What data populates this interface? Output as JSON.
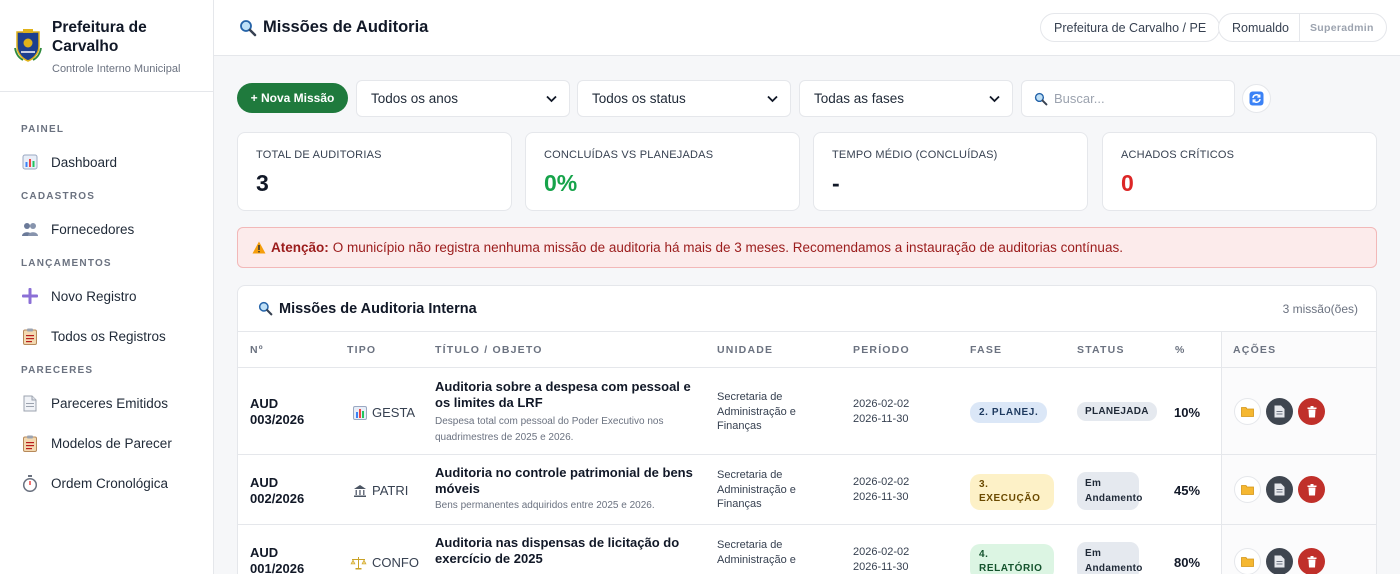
{
  "brand": {
    "name": "Prefeitura de Carvalho",
    "subtitle": "Controle Interno Municipal"
  },
  "sidebar": {
    "sections": [
      {
        "title": "PAINEL",
        "items": [
          {
            "label": "Dashboard",
            "icon": "chart-icon"
          }
        ]
      },
      {
        "title": "CADASTROS",
        "items": [
          {
            "label": "Fornecedores",
            "icon": "users-icon"
          }
        ]
      },
      {
        "title": "LANÇAMENTOS",
        "items": [
          {
            "label": "Novo Registro",
            "icon": "plus-icon"
          },
          {
            "label": "Todos os Registros",
            "icon": "clipboard-icon"
          }
        ]
      },
      {
        "title": "PARECERES",
        "items": [
          {
            "label": "Pareceres Emitidos",
            "icon": "document-icon"
          },
          {
            "label": "Modelos de Parecer",
            "icon": "clipboard-icon"
          },
          {
            "label": "Ordem Cronológica",
            "icon": "stopwatch-icon"
          }
        ]
      }
    ]
  },
  "header": {
    "title": "Missões de Auditoria",
    "tenant": "Prefeitura de Carvalho / PE",
    "user": "Romualdo",
    "role": "Superadmin"
  },
  "toolbar": {
    "new_label": "+ Nova Missão",
    "year_filter": "Todos os anos",
    "status_filter": "Todos os status",
    "phase_filter": "Todas as fases",
    "search_placeholder": "Buscar..."
  },
  "stats": [
    {
      "label": "TOTAL DE AUDITORIAS",
      "value": "3",
      "color": "#111827"
    },
    {
      "label": "CONCLUÍDAS VS PLANEJADAS",
      "value": "0%",
      "color": "#16a34a"
    },
    {
      "label": "TEMPO MÉDIO (CONCLUÍDAS)",
      "value": "-",
      "color": "#111827"
    },
    {
      "label": "ACHADOS CRÍTICOS",
      "value": "0",
      "color": "#dc2626"
    }
  ],
  "alert": {
    "label": "Atenção:",
    "message": "O município não registra nenhuma missão de auditoria há mais de 3 meses. Recomendamos a instauração de auditorias contínuas."
  },
  "table": {
    "title": "Missões de Auditoria Interna",
    "count": "3 missão(ões)",
    "columns": [
      "Nº",
      "TIPO",
      "TÍTULO / OBJETO",
      "UNIDADE",
      "PERÍODO",
      "FASE",
      "STATUS",
      "%",
      "AÇÕES"
    ],
    "rows": [
      {
        "num": "AUD 003/2026",
        "tipo": "GESTA",
        "tipo_icon": "bar-chart-icon",
        "titulo": "Auditoria sobre a despesa com pessoal e os limites da LRF",
        "descricao": "Despesa total com pessoal do Poder Executivo nos quadrimestres de 2025 e 2026.",
        "unidade": "Secretaria de Administração e Finanças",
        "inicio": "2026-02-02",
        "fim": "2026-11-30",
        "fase": "2. PLANEJ.",
        "fase_bg": "#dbe7f7",
        "fase_fg": "#1e3a5f",
        "status": "PLANEJADA",
        "pct": "10%"
      },
      {
        "num": "AUD 002/2026",
        "tipo": "PATRI",
        "tipo_icon": "building-icon",
        "titulo": "Auditoria no controle patrimonial de bens móveis",
        "descricao": "Bens permanentes adquiridos entre 2025 e 2026.",
        "unidade": "Secretaria de Administração e Finanças",
        "inicio": "2026-02-02",
        "fim": "2026-11-30",
        "fase": "3. EXECUÇÃO",
        "fase_bg": "#fdf1c7",
        "fase_fg": "#6b4a00",
        "status": "Em Andamento",
        "pct": "45%"
      },
      {
        "num": "AUD 001/2026",
        "tipo": "CONFO",
        "tipo_icon": "scales-icon",
        "titulo": "Auditoria nas dispensas de licitação do exercício de 2025",
        "descricao": "",
        "unidade": "Secretaria de Administração e",
        "inicio": "2026-02-02",
        "fim": "2026-11-30",
        "fase": "4. RELATÓRIO",
        "fase_bg": "#dcf5e3",
        "fase_fg": "#14532d",
        "status": "Em Andamento",
        "pct": "80%"
      }
    ]
  }
}
